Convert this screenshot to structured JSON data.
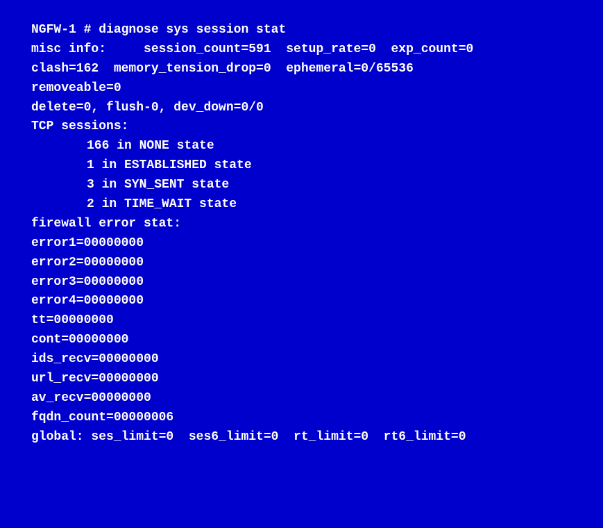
{
  "terminal": {
    "background_color": "#0000cc",
    "text_color": "#ffffff",
    "lines": [
      {
        "id": "cmd",
        "text": "NGFW-1 # diagnose sys session stat",
        "indent": false
      },
      {
        "id": "misc",
        "text": "misc info:     session_count=591  setup_rate=0  exp_count=0",
        "indent": false
      },
      {
        "id": "clash",
        "text": "clash=162  memory_tension_drop=0  ephemeral=0/65536",
        "indent": false
      },
      {
        "id": "removeable",
        "text": "removeable=0",
        "indent": false
      },
      {
        "id": "delete",
        "text": "delete=0, flush-0, dev_down=0/0",
        "indent": false
      },
      {
        "id": "tcp",
        "text": "TCP sessions:",
        "indent": false
      },
      {
        "id": "tcp1",
        "text": "166 in NONE state",
        "indent": true
      },
      {
        "id": "tcp2",
        "text": "1 in ESTABLISHED state",
        "indent": true
      },
      {
        "id": "tcp3",
        "text": "3 in SYN_SENT state",
        "indent": true
      },
      {
        "id": "tcp4",
        "text": "2 in TIME_WAIT state",
        "indent": true
      },
      {
        "id": "fw",
        "text": "firewall error stat:",
        "indent": false
      },
      {
        "id": "err1",
        "text": "error1=00000000",
        "indent": false
      },
      {
        "id": "err2",
        "text": "error2=00000000",
        "indent": false
      },
      {
        "id": "err3",
        "text": "error3=00000000",
        "indent": false
      },
      {
        "id": "err4",
        "text": "error4=00000000",
        "indent": false
      },
      {
        "id": "tt",
        "text": "tt=00000000",
        "indent": false
      },
      {
        "id": "cont",
        "text": "cont=00000000",
        "indent": false
      },
      {
        "id": "ids",
        "text": "ids_recv=00000000",
        "indent": false
      },
      {
        "id": "url",
        "text": "url_recv=00000000",
        "indent": false
      },
      {
        "id": "av",
        "text": "av_recv=00000000",
        "indent": false
      },
      {
        "id": "fqdn",
        "text": "fqdn_count=00000006",
        "indent": false
      },
      {
        "id": "global",
        "text": "global: ses_limit=0  ses6_limit=0  rt_limit=0  rt6_limit=0",
        "indent": false
      }
    ]
  }
}
